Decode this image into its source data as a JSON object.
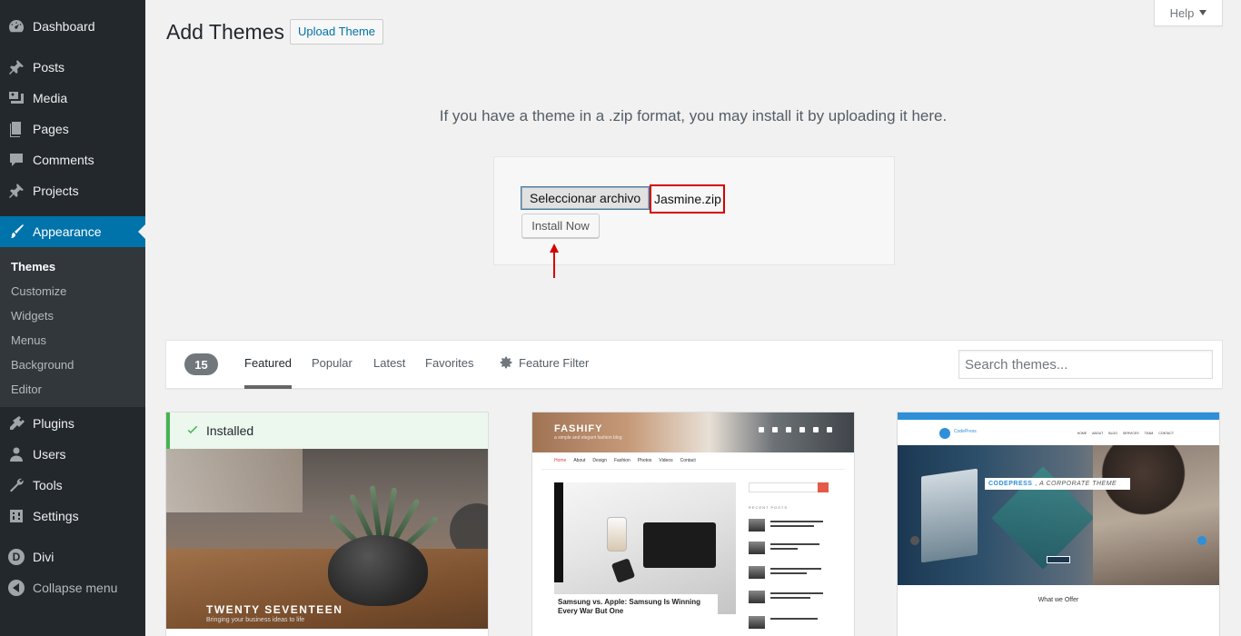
{
  "sidebar": {
    "items": [
      {
        "label": "Dashboard",
        "icon": "dashboard-icon"
      },
      {
        "label": "Posts",
        "icon": "pin-icon"
      },
      {
        "label": "Media",
        "icon": "media-icon"
      },
      {
        "label": "Pages",
        "icon": "pages-icon"
      },
      {
        "label": "Comments",
        "icon": "comment-icon"
      },
      {
        "label": "Projects",
        "icon": "pin-icon"
      },
      {
        "label": "Appearance",
        "icon": "paintbrush-icon"
      },
      {
        "label": "Plugins",
        "icon": "plugin-icon"
      },
      {
        "label": "Users",
        "icon": "users-icon"
      },
      {
        "label": "Tools",
        "icon": "wrench-icon"
      },
      {
        "label": "Settings",
        "icon": "settings-icon"
      },
      {
        "label": "Divi",
        "icon": "divi-icon",
        "badge": "D"
      },
      {
        "label": "Collapse menu",
        "icon": "collapse-icon"
      }
    ],
    "submenu": [
      "Themes",
      "Customize",
      "Widgets",
      "Menus",
      "Background",
      "Editor"
    ],
    "current": "Appearance",
    "current_sub": "Themes"
  },
  "header": {
    "title": "Add Themes",
    "upload_button": "Upload Theme",
    "help": "Help"
  },
  "upload": {
    "help_text": "If you have a theme in a .zip format, you may install it by uploading it here.",
    "file_button": "Seleccionar archivo",
    "file_name": "Jasmine.zip",
    "install_button": "Install Now"
  },
  "filter": {
    "count": "15",
    "tabs": [
      "Featured",
      "Popular",
      "Latest",
      "Favorites"
    ],
    "current_tab": "Featured",
    "feature_filter": "Feature Filter",
    "search_placeholder": "Search themes..."
  },
  "themes": [
    {
      "installed_label": "Installed",
      "screenshot_title": "TWENTY SEVENTEEN",
      "screenshot_subtitle": "Bringing your business ideas to life"
    },
    {
      "screenshot_title": "FASHIFY",
      "screenshot_tagline": "a simple and elegant fashion blog",
      "nav": [
        "Home",
        "About",
        "Design",
        "Fashion",
        "Photos",
        "Videos",
        "Contact"
      ],
      "sidebar_title": "RECENT POSTS",
      "caption": "Samsung vs. Apple: Samsung Is Winning Every War But One"
    },
    {
      "screenshot_title": "CODEPRESS",
      "screenshot_subtitle": ", A CORPORATE THEME",
      "logo": "CodePress",
      "nav": [
        "HOME",
        "ABOUT",
        "BLOG",
        "SERVICES",
        "TEAM",
        "CONTACT"
      ],
      "section": "What we Offer"
    }
  ],
  "colors": {
    "sidebar_bg": "#23282d",
    "accent": "#0073aa",
    "installed_green": "#46b450",
    "annotation_red": "#d60000"
  }
}
